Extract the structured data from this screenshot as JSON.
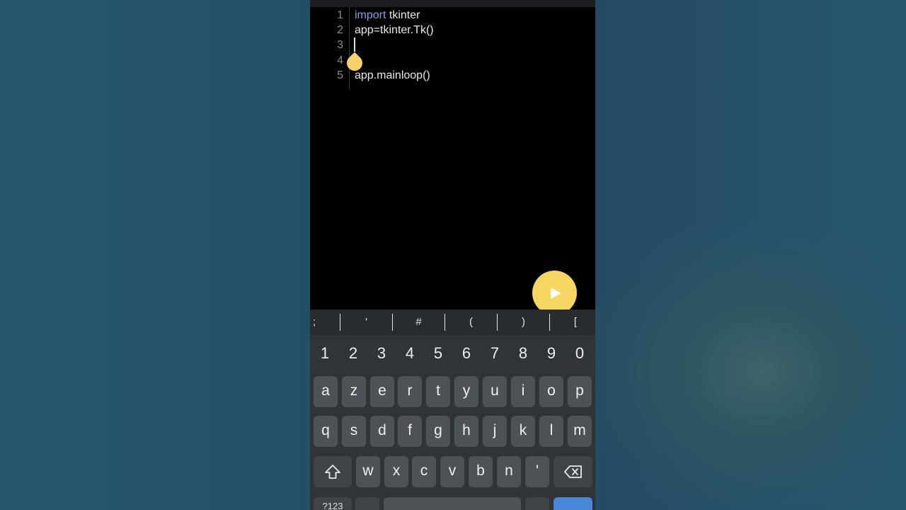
{
  "editor": {
    "lines": [
      {
        "num": "1",
        "keyword": "import",
        "text": " tkinter"
      },
      {
        "num": "2",
        "keyword": "",
        "text": "app=tkinter.Tk()"
      },
      {
        "num": "3",
        "keyword": "",
        "text": ""
      },
      {
        "num": "4",
        "keyword": "",
        "text": ""
      },
      {
        "num": "5",
        "keyword": "",
        "text": "app.mainloop()"
      }
    ]
  },
  "run_button": {
    "icon": "play-icon"
  },
  "symbols": [
    ";",
    "'",
    "#",
    "(",
    ")",
    "["
  ],
  "keyboard": {
    "numbers": [
      "1",
      "2",
      "3",
      "4",
      "5",
      "6",
      "7",
      "8",
      "9",
      "0"
    ],
    "row1": [
      "a",
      "z",
      "e",
      "r",
      "t",
      "y",
      "u",
      "i",
      "o",
      "p"
    ],
    "row2": [
      "q",
      "s",
      "d",
      "f",
      "g",
      "h",
      "j",
      "k",
      "l",
      "m"
    ],
    "row3": [
      "w",
      "x",
      "c",
      "v",
      "b",
      "n",
      "'"
    ],
    "shift_icon": "shift-icon",
    "backspace_icon": "backspace-icon",
    "mode_label": "?123"
  },
  "colors": {
    "accent": "#f6d663",
    "keyword": "#8d9ae0",
    "enter": "#4a86d8"
  }
}
